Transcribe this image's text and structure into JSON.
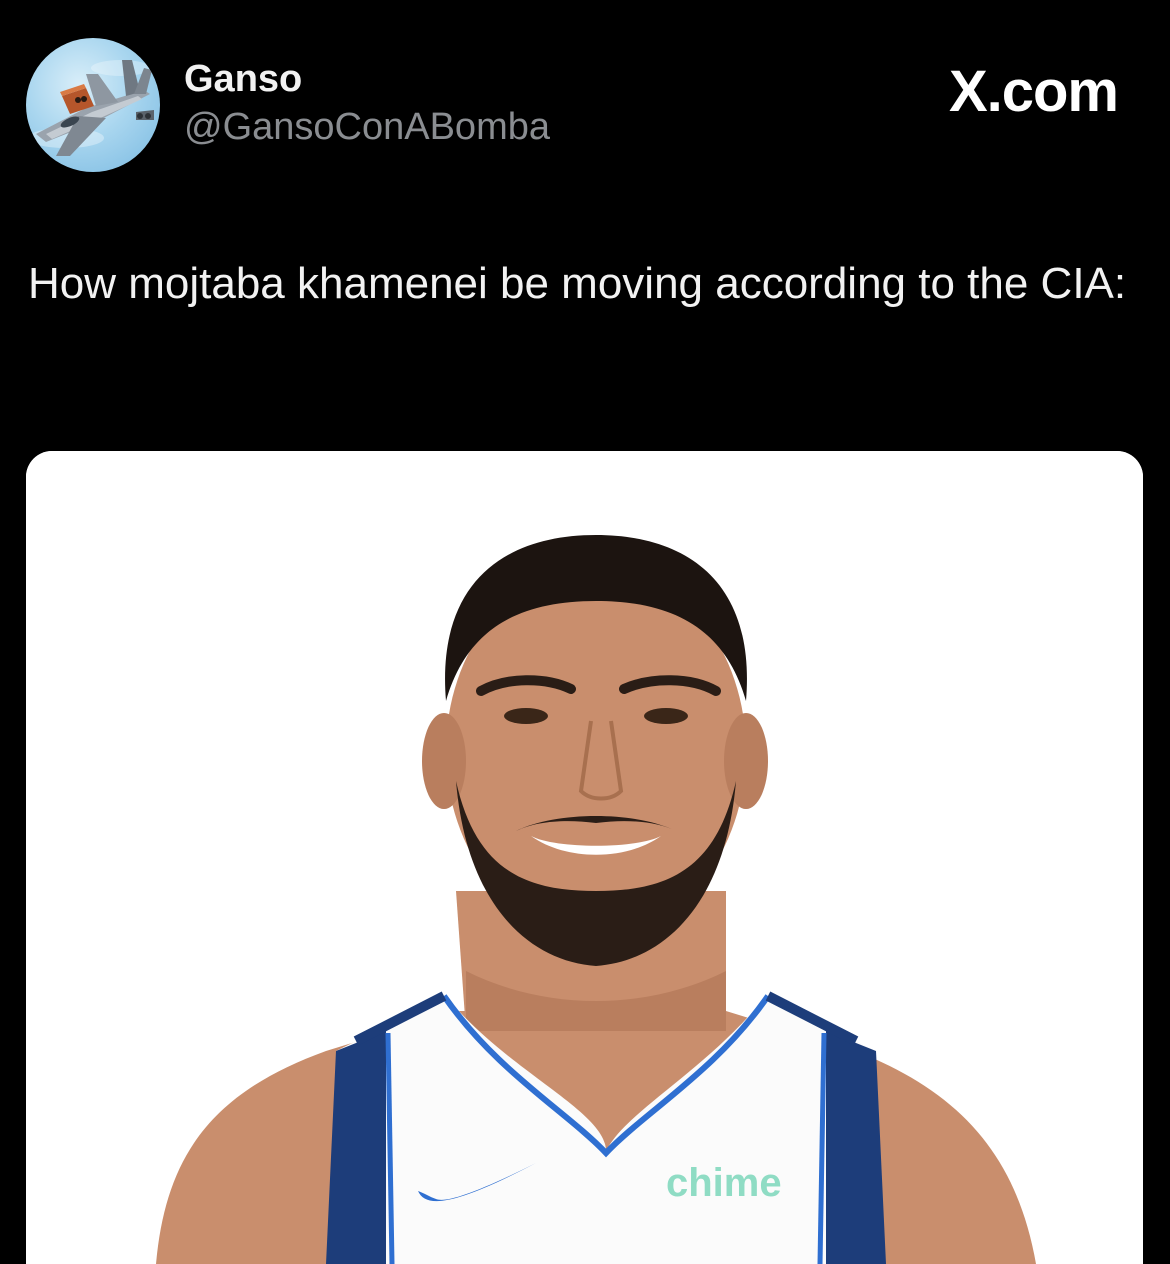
{
  "account": {
    "display_name": "Ganso",
    "handle": "@GansoConABomba",
    "avatar_icon": "fighter-jet-avatar"
  },
  "brand": {
    "label": "X.com"
  },
  "post": {
    "text": "How mojtaba khamenei be moving according to the CIA:",
    "media": {
      "jersey_sponsor": "chime",
      "jersey_logo_icon": "swoosh-logo-icon"
    }
  },
  "colors": {
    "background": "#000000",
    "handle_text": "#8a8d91",
    "media_background": "#ffffff",
    "jersey_trim": "#1d3d7a",
    "jersey_piping": "#2f6fd1",
    "sponsor_mint": "#8fdcc4"
  }
}
